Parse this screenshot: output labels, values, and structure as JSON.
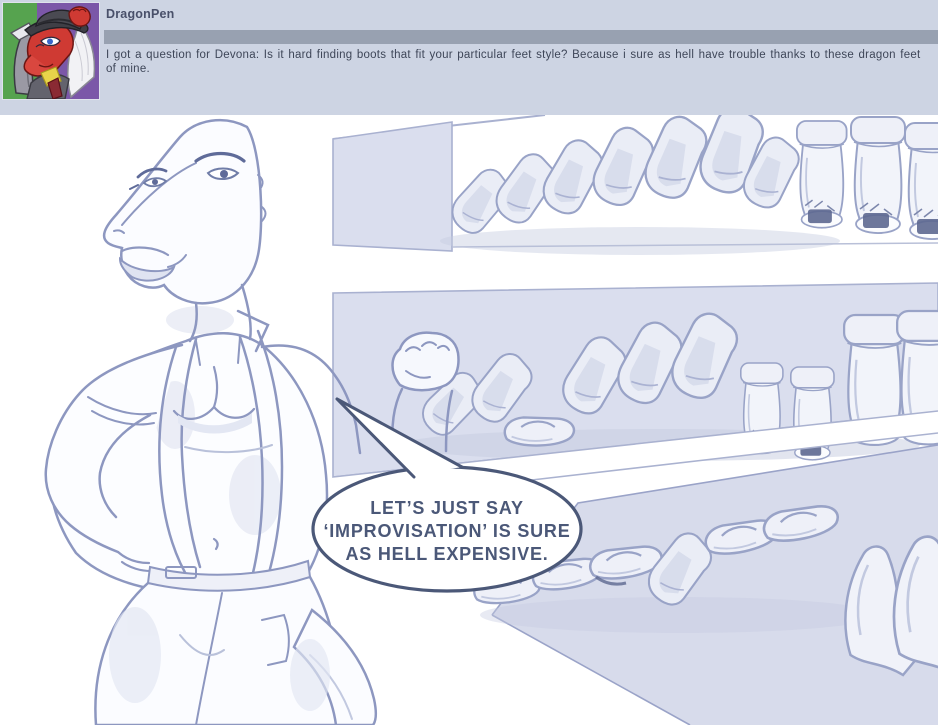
{
  "header": {
    "username": "DragonPen",
    "question": "I got a question for Devona: Is it hard finding boots that fit your particular feet style? Because i sure as hell have trouble thanks to these dragon feet of mine."
  },
  "comic": {
    "speech_bubble": {
      "lines": [
        "LET’S JUST SAY",
        "‘IMPROVISATION’ IS SURE",
        "AS HELL EXPENSIVE."
      ]
    }
  },
  "colors": {
    "header_bg": "#cdd4e3",
    "divider_bar": "#98a1b1",
    "panel_bg": "#ffffff",
    "sketch_line": "#8d97c0",
    "sketch_fill_light": "#dadeee",
    "bubble_stroke": "#4b5878",
    "question_text": "#3e4658",
    "username_text": "#49506a",
    "avatar_green": "#56a34f",
    "avatar_purple": "#7b57a8"
  }
}
